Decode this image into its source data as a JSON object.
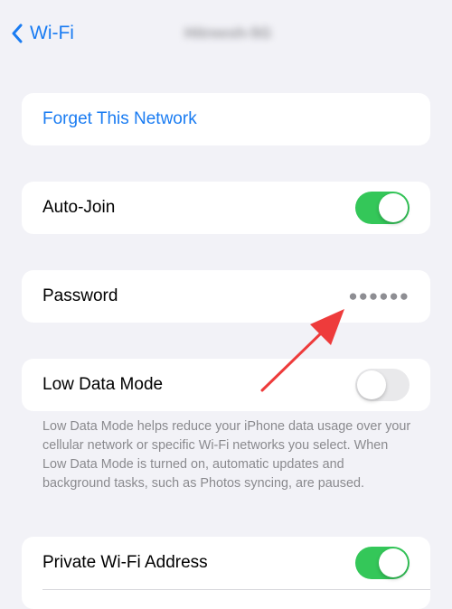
{
  "nav": {
    "back_label": "Wi-Fi",
    "title": "Hitreesh-5G"
  },
  "forget_network": {
    "label": "Forget This Network"
  },
  "auto_join": {
    "label": "Auto-Join",
    "enabled": true
  },
  "password": {
    "label": "Password",
    "value": "●●●●●●"
  },
  "low_data_mode": {
    "label": "Low Data Mode",
    "enabled": false,
    "footnote": "Low Data Mode helps reduce your iPhone data usage over your cellular network or specific Wi-Fi networks you select. When Low Data Mode is turned on, automatic updates and background tasks, such as Photos syncing, are paused."
  },
  "private_address": {
    "label": "Private Wi-Fi Address",
    "enabled": true
  },
  "colors": {
    "accent": "#1a7cf2",
    "toggle_on": "#34c759",
    "annotation_arrow": "#ee3b3b"
  }
}
